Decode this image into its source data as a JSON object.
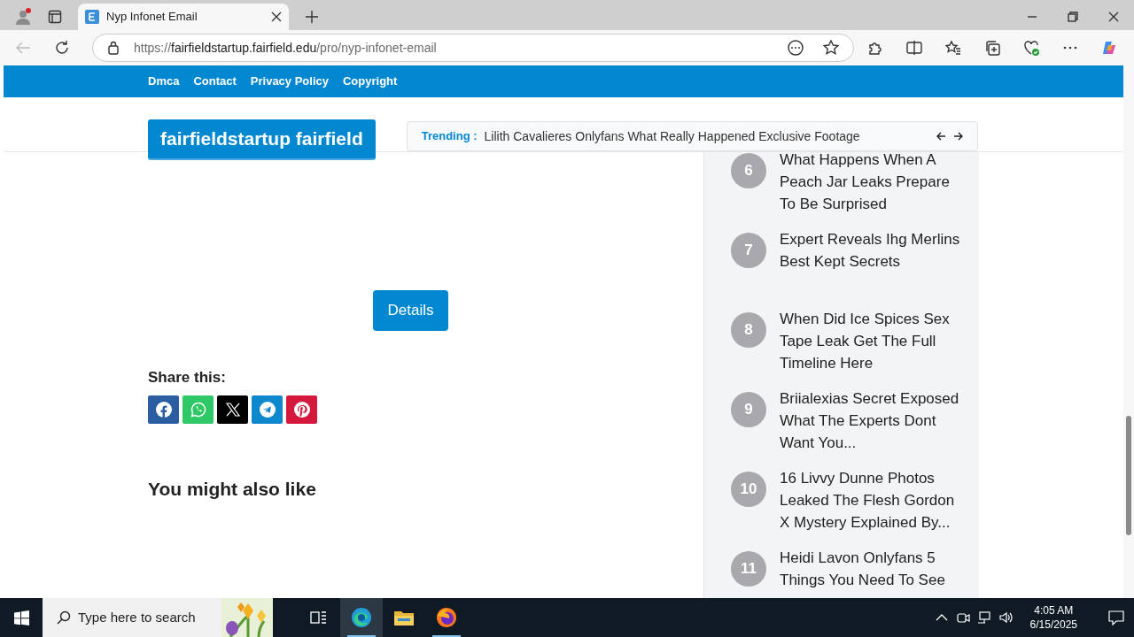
{
  "browser": {
    "tab_title": "Nyp Infonet Email",
    "url_scheme": "https://",
    "url_host": "fairfieldstartup.fairfield.edu",
    "url_path": "/pro/nyp-infonet-email"
  },
  "top_nav": [
    "Dmca",
    "Contact",
    "Privacy Policy",
    "Copyright"
  ],
  "logo": "fairfieldstartup fairfield",
  "trending": {
    "label": "Trending :",
    "headline": "Lilith Cavalieres Onlyfans What Really Happened Exclusive Footage"
  },
  "details_button": "Details",
  "share": {
    "title": "Share this:",
    "buttons": [
      {
        "kind": "facebook",
        "color": "#2a5ea0"
      },
      {
        "kind": "whatsapp",
        "color": "#2fc867"
      },
      {
        "kind": "x",
        "color": "#000000"
      },
      {
        "kind": "telegram",
        "color": "#0e88cc"
      },
      {
        "kind": "pinterest",
        "color": "#d4193d"
      }
    ]
  },
  "related_title": "You might also like",
  "sidebar": {
    "items": [
      {
        "rank": "6",
        "title": "What Happens When A Peach Jar Leaks Prepare To Be Surprised"
      },
      {
        "rank": "7",
        "title": "Expert Reveals Ihg Merlins Best Kept Secrets"
      },
      {
        "rank": "8",
        "title": "When Did Ice Spices Sex Tape Leak Get The Full Timeline Here"
      },
      {
        "rank": "9",
        "title": "Briialexias Secret Exposed What The Experts Dont Want You..."
      },
      {
        "rank": "10",
        "title": "16 Livvy Dunne Photos Leaked The Flesh Gordon X Mystery Explained By..."
      },
      {
        "rank": "11",
        "title": "Heidi Lavon Onlyfans 5 Things You Need To See"
      }
    ]
  },
  "taskbar": {
    "search_placeholder": "Type here to search",
    "apps": [
      {
        "kind": "taskview",
        "active": false,
        "running": false
      },
      {
        "kind": "edge",
        "active": true,
        "running": true
      },
      {
        "kind": "explorer",
        "active": false,
        "running": false
      },
      {
        "kind": "firefox",
        "active": false,
        "running": true
      }
    ],
    "time": "4:05 AM",
    "date": "6/15/2025"
  }
}
